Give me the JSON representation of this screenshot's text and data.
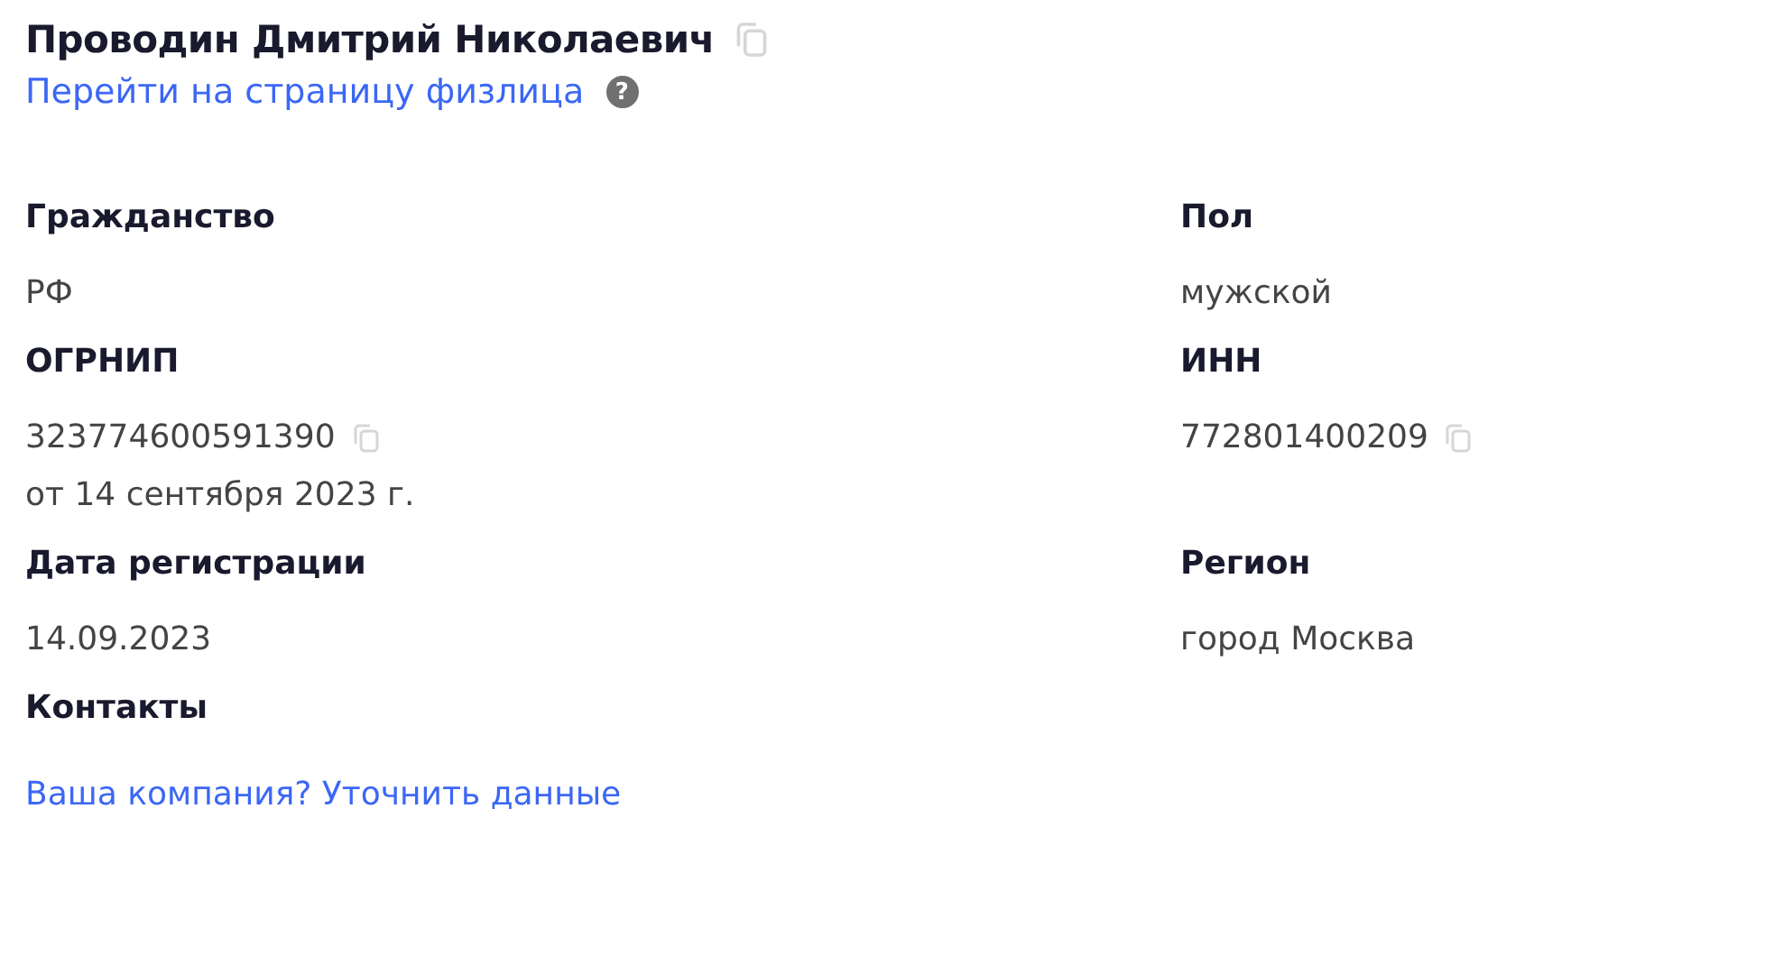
{
  "person": {
    "name": "Проводин Дмитрий Николаевич",
    "name_copyable": true,
    "link": "Перейти на страницу физлица",
    "help_mark": "?"
  },
  "rows": [
    [
      {
        "label": "Гражданство",
        "value": "РФ",
        "copyable": false
      },
      {
        "label": "Пол",
        "value": "мужской",
        "copyable": false
      }
    ],
    [
      {
        "label": "ОГРНИП",
        "value": "323774600591390",
        "copyable": true,
        "note": "от 14 сентября 2023 г."
      },
      {
        "label": "ИНН",
        "value": "772801400209",
        "copyable": true
      }
    ],
    [
      {
        "label": "Дата регистрации",
        "value": "14.09.2023",
        "copyable": false
      },
      {
        "label": "Регион",
        "value": "город Москва",
        "copyable": false
      }
    ]
  ],
  "contacts": {
    "label": "Контакты",
    "link": "Ваша компания? Уточнить данные"
  }
}
